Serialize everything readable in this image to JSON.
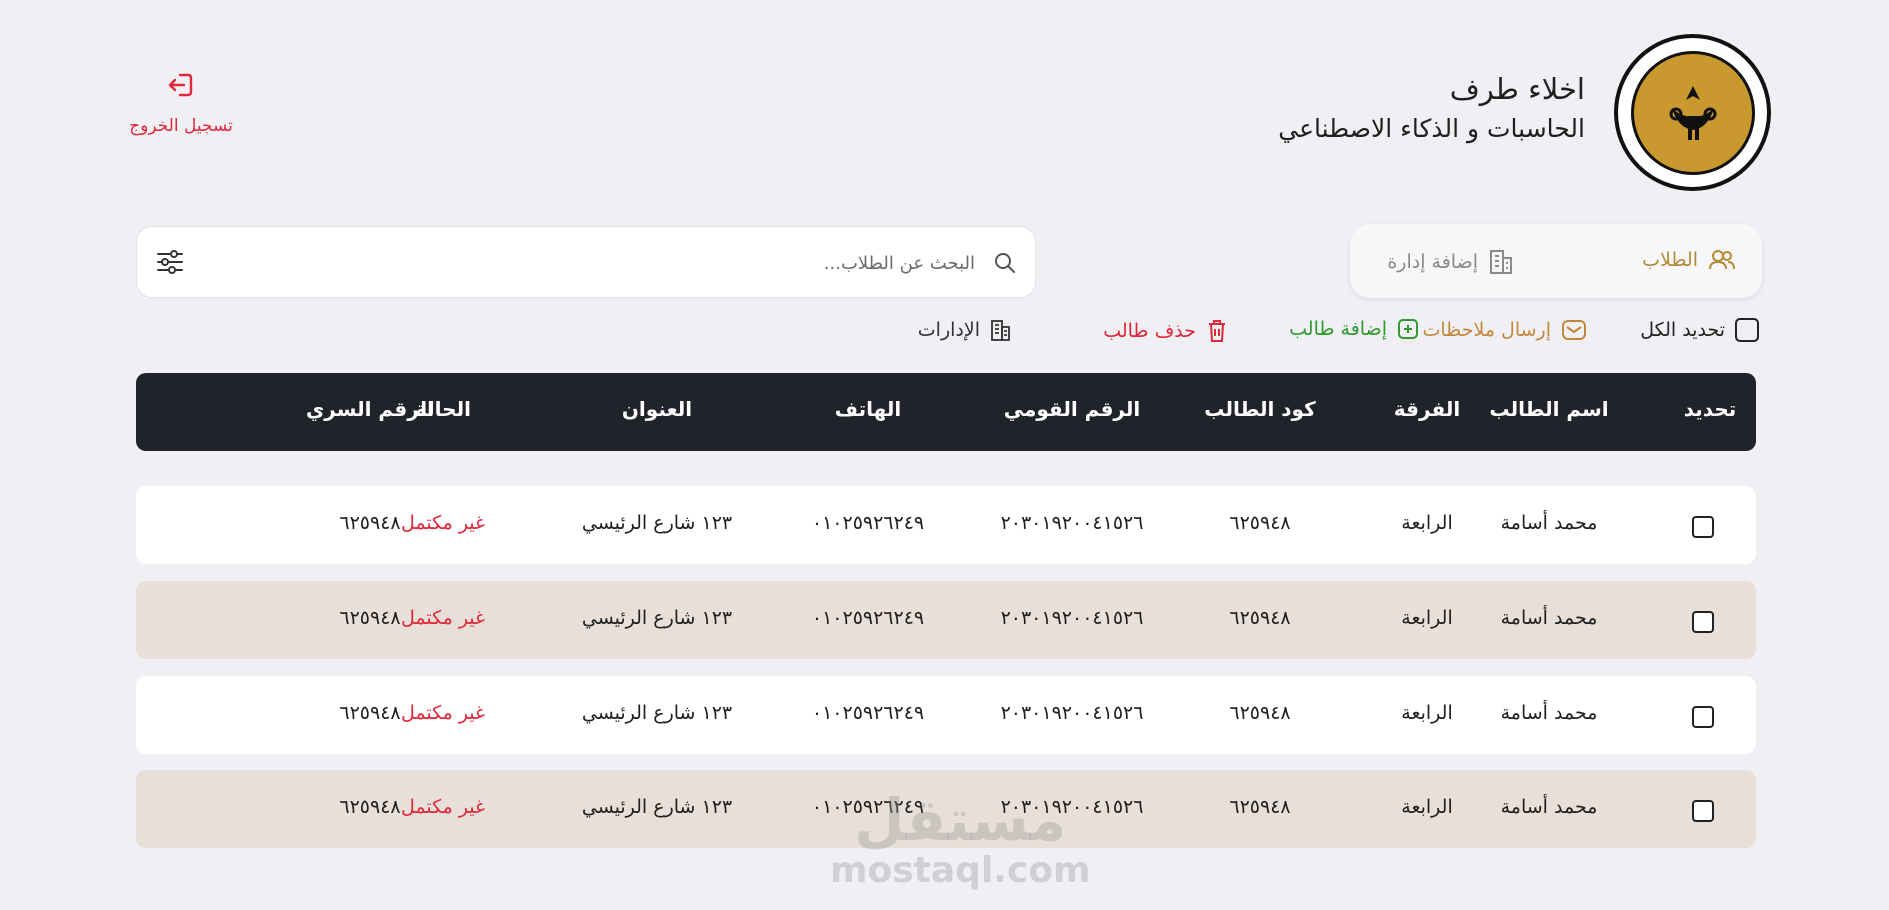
{
  "header": {
    "user_name": "اخلاء طرف",
    "department": "الحاسبات و الذكاء الاصطناعي",
    "logo_icon": "university-seal-icon",
    "logout_label": "تسجيل الخروج"
  },
  "tabs": {
    "students_label": "الطلاب",
    "add_admin_label": "إضافة إدارة"
  },
  "search": {
    "placeholder": "البحث عن الطلاب..."
  },
  "actions": {
    "select_all": "تحديد الكل",
    "send_notes": "إرسال ملاحظات",
    "add_student": "إضافة طالب",
    "delete_student": "حذف طالب",
    "admins": "الإدارات"
  },
  "table": {
    "headers": {
      "select": "تحديد",
      "name": "اسم الطالب",
      "year": "الفرقة",
      "code": "كود الطالب",
      "national_id": "الرقم القومي",
      "phone": "الهاتف",
      "address": "العنوان",
      "status": "الحالة",
      "password": "الرقم السري"
    },
    "rows": [
      {
        "name": "محمد أسامة",
        "year": "الرابعة",
        "code": "٦٢٥٩٤٨",
        "national_id": "٢٠٣٠١٩٢٠٠٤١٥٢٦",
        "phone": "٠١٠٢٥٩٢٦٢٤٩",
        "address": "١٢٣ شارع الرئيسي",
        "status": "غير مكتمل",
        "password": "٦٢٥٩٤٨"
      },
      {
        "name": "محمد أسامة",
        "year": "الرابعة",
        "code": "٦٢٥٩٤٨",
        "national_id": "٢٠٣٠١٩٢٠٠٤١٥٢٦",
        "phone": "٠١٠٢٥٩٢٦٢٤٩",
        "address": "١٢٣ شارع الرئيسي",
        "status": "غير مكتمل",
        "password": "٦٢٥٩٤٨"
      },
      {
        "name": "محمد أسامة",
        "year": "الرابعة",
        "code": "٦٢٥٩٤٨",
        "national_id": "٢٠٣٠١٩٢٠٠٤١٥٢٦",
        "phone": "٠١٠٢٥٩٢٦٢٤٩",
        "address": "١٢٣ شارع الرئيسي",
        "status": "غير مكتمل",
        "password": "٦٢٥٩٤٨"
      },
      {
        "name": "محمد أسامة",
        "year": "الرابعة",
        "code": "٦٢٥٩٤٨",
        "national_id": "٢٠٣٠١٩٢٠٠٤١٥٢٦",
        "phone": "٠١٠٢٥٩٢٦٢٤٩",
        "address": "١٢٣ شارع الرئيسي",
        "status": "غير مكتمل",
        "password": "٦٢٥٩٤٨"
      }
    ]
  },
  "watermark": {
    "arabic": "مستقل",
    "latin": "mostaql.com"
  },
  "colors": {
    "accent_gold": "#b58a35",
    "danger": "#e0283a",
    "success": "#2e9b2e",
    "table_header": "#20242a",
    "row_alt": "#e8dfd8"
  }
}
